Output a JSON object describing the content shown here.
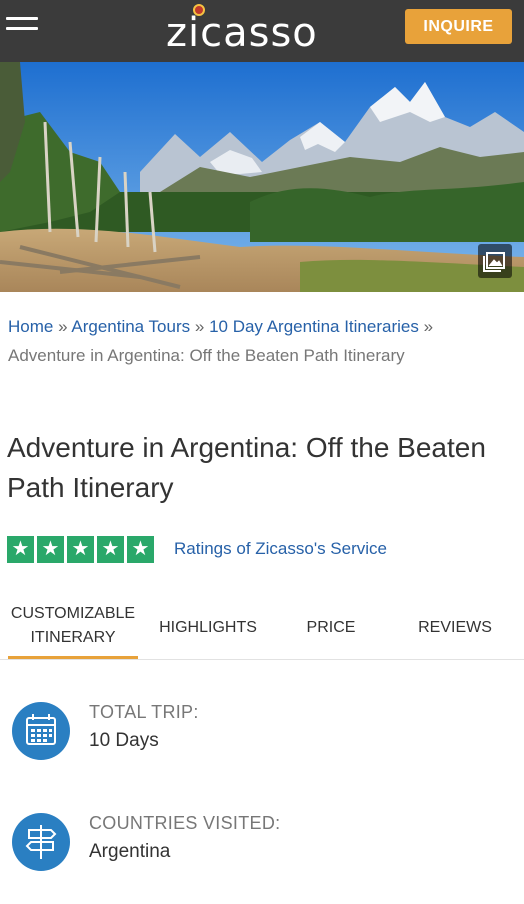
{
  "header": {
    "logo_text": "zicasso",
    "inquire_label": "INQUIRE"
  },
  "breadcrumb": {
    "home": "Home",
    "sep": "»",
    "argentina_tours": "Argentina Tours",
    "itineraries": "10 Day Argentina Itineraries",
    "current": "Adventure in Argentina: Off the Beaten Path Itinerary"
  },
  "title": "Adventure in Argentina: Off the Beaten Path Itinerary",
  "rating": {
    "stars": 5,
    "link_text": "Ratings of Zicasso's Service"
  },
  "tabs": [
    {
      "label": "CUSTOMIZABLE ITINERARY",
      "active": true
    },
    {
      "label": "HIGHLIGHTS",
      "active": false
    },
    {
      "label": "PRICE",
      "active": false
    },
    {
      "label": "REVIEWS",
      "active": false
    }
  ],
  "info": [
    {
      "label": "TOTAL TRIP:",
      "value": "10 Days",
      "icon": "calendar-icon"
    },
    {
      "label": "COUNTRIES VISITED:",
      "value": "Argentina",
      "icon": "signpost-icon"
    }
  ],
  "colors": {
    "header_bg": "#3b3b3b",
    "accent": "#e8a23a",
    "link": "#2761a8",
    "star_green": "#2aa86a",
    "icon_blue": "#2a7fc2"
  }
}
